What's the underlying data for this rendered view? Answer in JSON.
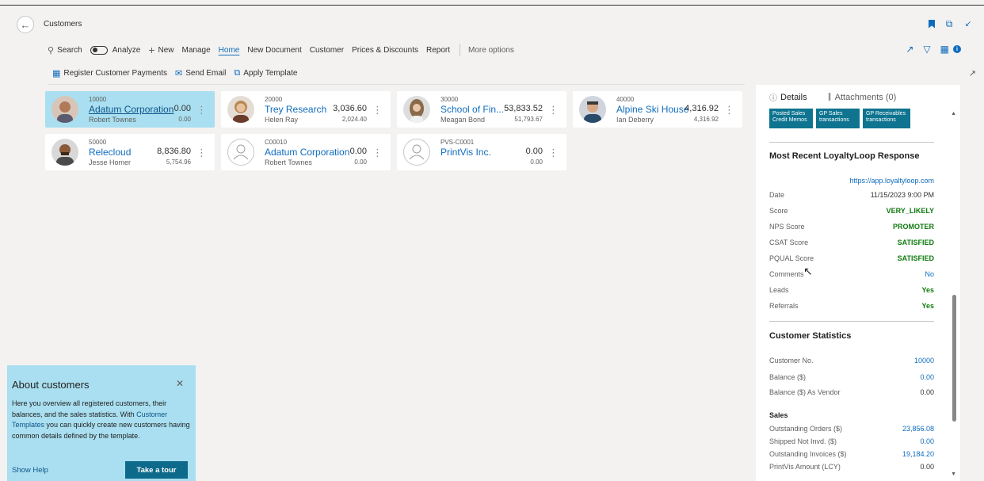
{
  "page": {
    "title": "Customers"
  },
  "actions": {
    "search": "Search",
    "analyze": "Analyze",
    "new": "New",
    "manage": "Manage",
    "home": "Home",
    "new_document": "New Document",
    "customer": "Customer",
    "prices": "Prices & Discounts",
    "report": "Report",
    "more": "More options"
  },
  "actions2": {
    "register": "Register Customer Payments",
    "send_email": "Send Email",
    "apply_template": "Apply Template"
  },
  "cards": [
    {
      "no": "10000",
      "name": "Adatum Corporation",
      "contact": "Robert Townes",
      "balance": "0.00",
      "balance2": "0.00"
    },
    {
      "no": "20000",
      "name": "Trey Research",
      "contact": "Helen Ray",
      "balance": "3,036.60",
      "balance2": "2,024.40"
    },
    {
      "no": "30000",
      "name": "School of Fin...",
      "contact": "Meagan Bond",
      "balance": "53,833.52",
      "balance2": "51,793.67"
    },
    {
      "no": "40000",
      "name": "Alpine Ski House",
      "contact": "Ian Deberry",
      "balance": "4,316.92",
      "balance2": "4,316.92"
    },
    {
      "no": "50000",
      "name": "Relecloud",
      "contact": "Jesse Homer",
      "balance": "8,836.80",
      "balance2": "5,754.96"
    },
    {
      "no": "C00010",
      "name": "Adatum Corporation",
      "contact": "Robert Townes",
      "balance": "0.00",
      "balance2": "0.00"
    },
    {
      "no": "PVS-C0001",
      "name": "PrintVis Inc.",
      "contact": "",
      "balance": "0.00",
      "balance2": "0.00"
    }
  ],
  "about": {
    "title": "About customers",
    "text1": "Here you overview all registered customers, their balances, and the sales statistics. With",
    "link": "Customer Templates",
    "text2": "you can quickly create new customers having common details defined by the template.",
    "show_help": "Show Help",
    "tour": "Take a tour"
  },
  "panel": {
    "tabs": {
      "details": "Details",
      "attachments": "Attachments (0)"
    },
    "tiles": [
      {
        "line1": "Posted Sales",
        "line2": "Credit Memos"
      },
      {
        "line1": "GP Sales",
        "line2": "transactions"
      },
      {
        "line1": "GP Receivables",
        "line2": "transactions"
      }
    ],
    "loyalty": {
      "title": "Most Recent LoyaltyLoop Response",
      "url": "https://app.loyaltyloop.com",
      "rows": [
        {
          "k": "Date",
          "v": "11/15/2023 9:00 PM"
        },
        {
          "k": "Score",
          "v": "VERY_LIKELY"
        },
        {
          "k": "NPS Score",
          "v": "PROMOTER"
        },
        {
          "k": "CSAT Score",
          "v": "SATISFIED"
        },
        {
          "k": "PQUAL Score",
          "v": "SATISFIED"
        },
        {
          "k": "Comments",
          "v": "No"
        },
        {
          "k": "Leads",
          "v": "Yes"
        },
        {
          "k": "Referrals",
          "v": "Yes"
        }
      ]
    },
    "stats": {
      "title": "Customer Statistics",
      "rows": [
        {
          "k": "Customer No.",
          "v": "10000"
        },
        {
          "k": "Balance ($)",
          "v": "0.00"
        },
        {
          "k": "Balance ($) As Vendor",
          "v": "0.00"
        }
      ],
      "sales_title": "Sales",
      "sales": [
        {
          "k": "Outstanding Orders ($)",
          "v": "23,856.08"
        },
        {
          "k": "Shipped Not Invd. ($)",
          "v": "0.00"
        },
        {
          "k": "Outstanding Invoices ($)",
          "v": "19,184.20"
        },
        {
          "k": "PrintVis Amount (LCY)",
          "v": "0.00"
        }
      ]
    }
  },
  "colors": {
    "accent": "#0f6cbd",
    "selected": "#a9dff0",
    "tile": "#0e7490",
    "positive": "#107c10"
  }
}
